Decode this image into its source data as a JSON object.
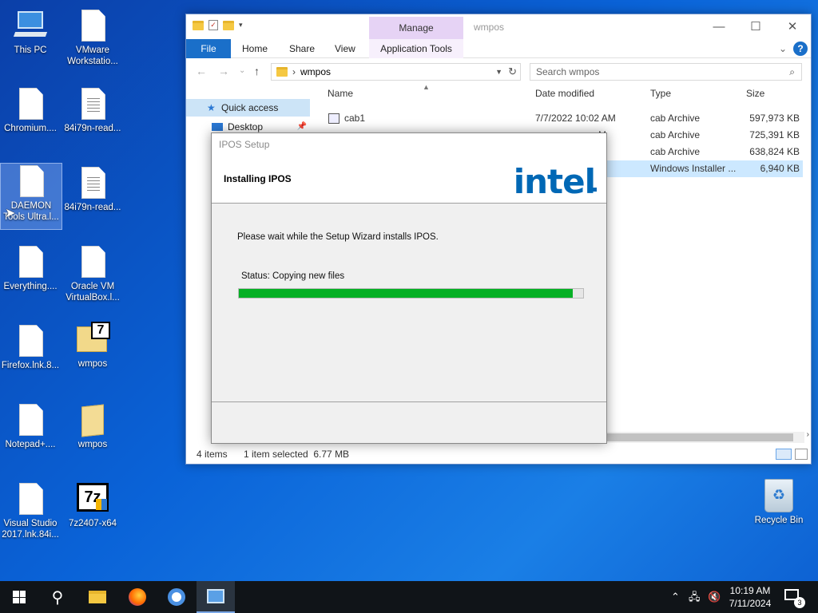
{
  "desktop": {
    "icons": [
      {
        "label": "This PC",
        "icon": "this-pc-icon"
      },
      {
        "label": "VMware Workstatio...",
        "icon": "document-icon"
      },
      {
        "label": "Chromium....",
        "icon": "document-icon"
      },
      {
        "label": "84i79n-read...",
        "icon": "text-document-icon"
      },
      {
        "label": "DAEMON Tools Ultra.l...",
        "icon": "document-icon"
      },
      {
        "label": "84i79n-read...",
        "icon": "text-document-icon"
      },
      {
        "label": "Everything....",
        "icon": "document-icon"
      },
      {
        "label": "Oracle VM VirtualBox.l...",
        "icon": "document-icon"
      },
      {
        "label": "Firefox.lnk.8...",
        "icon": "document-icon"
      },
      {
        "label": "wmpos",
        "icon": "7zip-archive-icon"
      },
      {
        "label": "Notepad+....",
        "icon": "document-icon"
      },
      {
        "label": "wmpos",
        "icon": "folder-icon"
      },
      {
        "label": "Visual Studio 2017.lnk.84i...",
        "icon": "document-icon"
      },
      {
        "label": "7z2407-x64",
        "icon": "7zip-installer-icon"
      }
    ],
    "recycle_bin": "Recycle Bin"
  },
  "explorer": {
    "title": "wmpos",
    "contextual_tab": "Manage",
    "ribbon_tabs": [
      "File",
      "Home",
      "Share",
      "View",
      "Application Tools"
    ],
    "address": "wmpos",
    "search_placeholder": "Search wmpos",
    "nav": {
      "quick_access": "Quick access",
      "desktop": "Desktop"
    },
    "columns": {
      "name": "Name",
      "date": "Date modified",
      "type": "Type",
      "size": "Size"
    },
    "files": [
      {
        "name": "cab1",
        "date": "7/7/2022 10:02 AM",
        "type": "cab Archive",
        "size": "597,973 KB"
      },
      {
        "name": "",
        "date": "M",
        "type": "cab Archive",
        "size": "725,391 KB"
      },
      {
        "name": "",
        "date": "M",
        "type": "cab Archive",
        "size": "638,824 KB"
      },
      {
        "name": "",
        "date": "M",
        "type": "Windows Installer ...",
        "size": "6,940 KB"
      }
    ],
    "status": {
      "items": "4 items",
      "selected": "1 item selected  6.77 MB"
    }
  },
  "setup": {
    "title": "IPOS Setup",
    "heading": "Installing IPOS",
    "logo_text": "intel",
    "message": "Please wait while the Setup Wizard installs IPOS.",
    "status": "Status: Copying new files",
    "progress": 0.97,
    "progress_color": "#06b025"
  },
  "taskbar": {
    "time": "10:19 AM",
    "date": "7/11/2024",
    "notification_count": "3"
  }
}
